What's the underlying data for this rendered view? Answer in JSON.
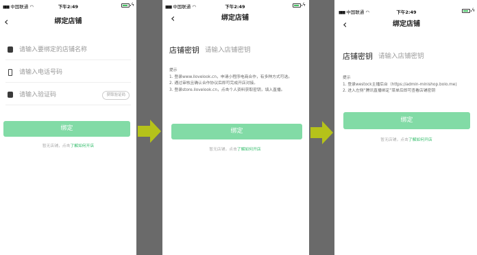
{
  "status": {
    "carrier": "中国联通",
    "time": "下午2:49"
  },
  "screens": [
    {
      "nav_back": "‹",
      "title": "绑定店铺",
      "fields": {
        "shop_name_placeholder": "请输入要绑定的店铺名称",
        "phone_placeholder": "请输入电话号码",
        "code_placeholder": "请输入验证码",
        "get_code": "获取验证码"
      },
      "bind_button": "绑定",
      "footer_prefix": "暂无店铺，点击",
      "footer_link": "了解如何开店"
    },
    {
      "nav_back": "‹",
      "title": "绑定店铺",
      "key_label": "店铺密钥",
      "key_placeholder": "请输入店铺密钥",
      "hint_title": "提示",
      "hints": [
        "1. 登录www.ilovelook.cn，申请小程序电商合作，有多种方式可选。",
        "2. 通过审核且确认合作协议后即可完成开店对接。",
        "3. 登录store.ilovelook.cn，点击个人资料获取密钥，填入直播。"
      ],
      "bind_button": "绑定",
      "footer_prefix": "暂无店铺，点击",
      "footer_link": "了解如何开店"
    },
    {
      "nav_back": "‹",
      "title": "绑定店铺",
      "key_label": "店铺密钥",
      "key_placeholder": "请输入店铺密钥",
      "hint_title": "提示",
      "hints": [
        "1. 登录westock主播后台（https://admin-minishop.bolo.me)",
        "2. 进入左侧“腾讯直播绑定”菜单后即可查看店铺密钥"
      ],
      "bind_button": "绑定",
      "footer_prefix": "暂无店铺，点击",
      "footer_link": "了解如何开店"
    }
  ],
  "colors": {
    "primary_button": "#82dba6",
    "link": "#2dbb66",
    "arrow": "#b5c21a",
    "gutter": "#6a6a6a"
  },
  "icons": [
    "signal-icon",
    "wifi-icon",
    "battery-icon",
    "back-chevron-icon",
    "store-icon",
    "phone-icon",
    "code-icon",
    "arrow-right-icon"
  ]
}
